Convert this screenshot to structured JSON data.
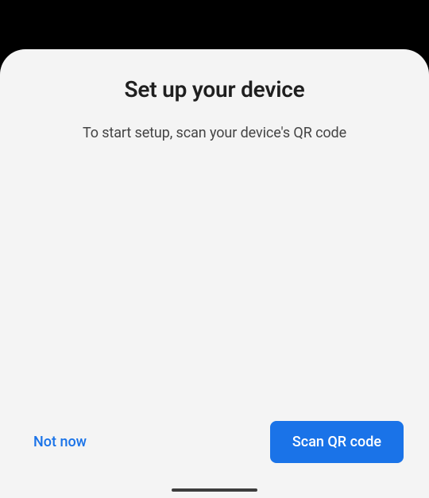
{
  "sheet": {
    "title": "Set up your device",
    "subtitle": "To start setup, scan your device's QR code"
  },
  "actions": {
    "secondary_label": "Not now",
    "primary_label": "Scan QR code"
  }
}
